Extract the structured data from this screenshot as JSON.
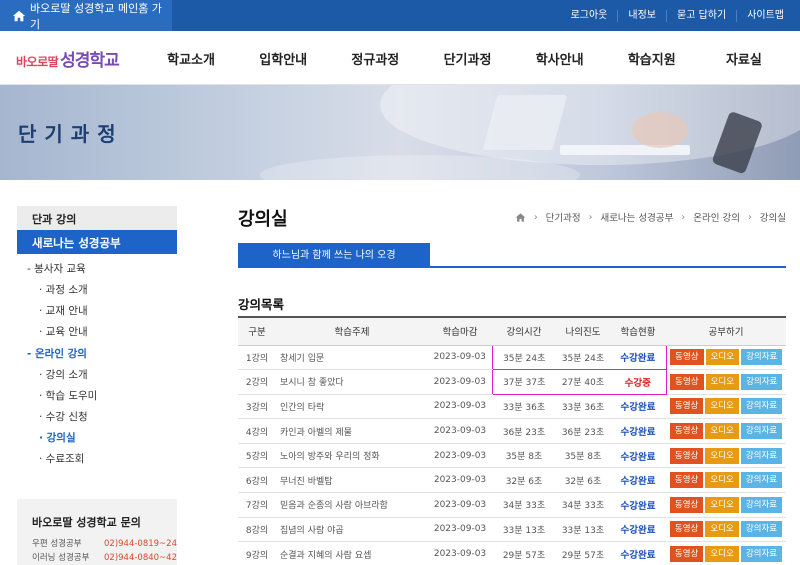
{
  "topbar": {
    "home_label": "바오로딸 성경학교 메인홈 가기",
    "links": [
      "로그아웃",
      "내정보",
      "묻고 답하기",
      "사이트맵"
    ]
  },
  "logo": {
    "part1": "바오로딸",
    "part2": "성경학교"
  },
  "nav": [
    "학교소개",
    "입학안내",
    "정규과정",
    "단기과정",
    "학사안내",
    "학습지원",
    "자료실"
  ],
  "banner": {
    "title": "단기과정"
  },
  "sidebar": {
    "heading": "단과 강의",
    "active": "새로나는 성경공부",
    "groups": [
      {
        "label": "- 봉사자 교육",
        "active": false,
        "items": [
          {
            "label": "· 과정 소개",
            "active": false
          },
          {
            "label": "· 교재 안내",
            "active": false
          },
          {
            "label": "· 교육 안내",
            "active": false
          }
        ]
      },
      {
        "label": "- 온라인 강의",
        "active": true,
        "items": [
          {
            "label": "· 강의 소개",
            "active": false
          },
          {
            "label": "· 학습 도우미",
            "active": false
          },
          {
            "label": "· 수강 신청",
            "active": false
          },
          {
            "label": "· 강의실",
            "active": true
          },
          {
            "label": "· 수료조회",
            "active": false
          }
        ]
      }
    ],
    "contact": {
      "title": "바오로딸 성경학교 문의",
      "rows": [
        {
          "k": "우편 성경공부",
          "v": "02)944-0819~24"
        },
        {
          "k": "이러닝 성경공부",
          "v": "02)944-0840~42"
        }
      ]
    }
  },
  "content": {
    "title": "강의실",
    "breadcrumb": [
      "단기과정",
      "새로나는 성경공부",
      "온라인 강의",
      "강의실"
    ],
    "tab": "하느님과 함께 쓰는 나의 오경",
    "section_title": "강의목록",
    "columns": [
      "구분",
      "학습주제",
      "학습마감",
      "강의시간",
      "나의진도",
      "학습현황",
      "공부하기"
    ],
    "buttons": {
      "video": "동영상",
      "audio": "오디오",
      "doc": "강의자료"
    },
    "rows": [
      {
        "no": "1강의",
        "subject": "창세기 입문",
        "deadline": "2023-09-03",
        "time": "35분 24초",
        "progress": "35분 24초",
        "status": "수강완료",
        "in_progress": false,
        "highlight": true
      },
      {
        "no": "2강의",
        "subject": "보시니 참 좋았다",
        "deadline": "2023-09-03",
        "time": "37분 37초",
        "progress": "27분 40초",
        "status": "수강중",
        "in_progress": true,
        "highlight": true
      },
      {
        "no": "3강의",
        "subject": "인간의 타락",
        "deadline": "2023-09-03",
        "time": "33분 36초",
        "progress": "33분 36초",
        "status": "수강완료",
        "in_progress": false,
        "highlight": false
      },
      {
        "no": "4강의",
        "subject": "카인과 아벨의 제물",
        "deadline": "2023-09-03",
        "time": "36분 23초",
        "progress": "36분 23초",
        "status": "수강완료",
        "in_progress": false,
        "highlight": false
      },
      {
        "no": "5강의",
        "subject": "노아의 방주와 우리의 정화",
        "deadline": "2023-09-03",
        "time": "35분 8초",
        "progress": "35분 8초",
        "status": "수강완료",
        "in_progress": false,
        "highlight": false
      },
      {
        "no": "6강의",
        "subject": "무너진 바벨탑",
        "deadline": "2023-09-03",
        "time": "32분 6초",
        "progress": "32분 6초",
        "status": "수강완료",
        "in_progress": false,
        "highlight": false
      },
      {
        "no": "7강의",
        "subject": "믿음과 순종의 사람 아브라함",
        "deadline": "2023-09-03",
        "time": "34분 33초",
        "progress": "34분 33초",
        "status": "수강완료",
        "in_progress": false,
        "highlight": false
      },
      {
        "no": "8강의",
        "subject": "집념의 사람 야곱",
        "deadline": "2023-09-03",
        "time": "33분 13초",
        "progress": "33분 13초",
        "status": "수강완료",
        "in_progress": false,
        "highlight": false
      },
      {
        "no": "9강의",
        "subject": "순결과 지혜의 사람 요셉",
        "deadline": "2023-09-03",
        "time": "29분 57초",
        "progress": "29분 57초",
        "status": "수강완료",
        "in_progress": false,
        "highlight": false
      }
    ]
  },
  "colors": {
    "primary": "#1d63c8",
    "topbar": "#1c5aa8",
    "highlight": "#e31ec8",
    "status_done": "#1d4fb8",
    "status_ing": "#e02020"
  }
}
